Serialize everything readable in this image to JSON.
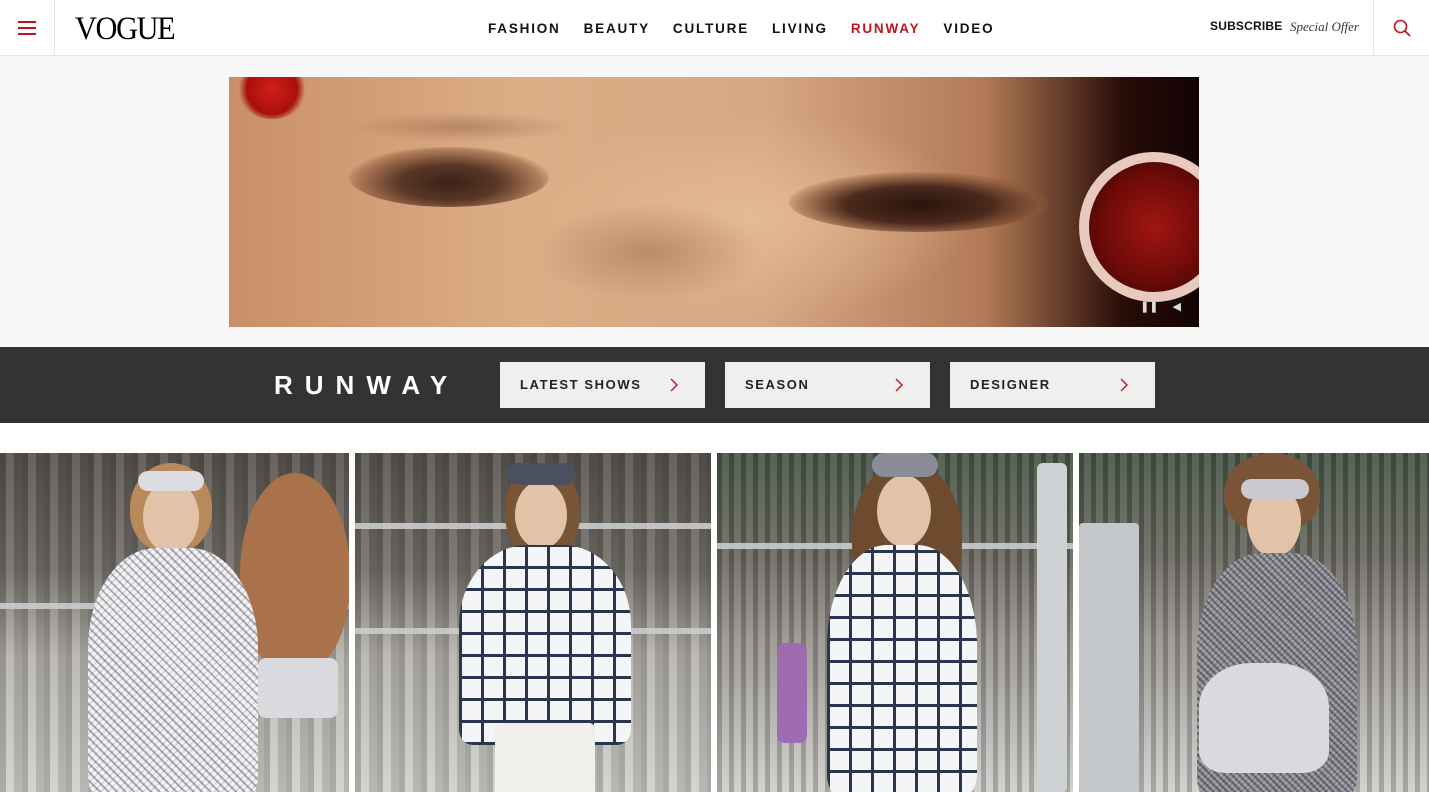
{
  "header": {
    "logo": "VOGUE",
    "nav": [
      "FASHION",
      "BEAUTY",
      "CULTURE",
      "LIVING",
      "RUNWAY",
      "VIDEO"
    ],
    "active_nav": "RUNWAY",
    "subscribe": "SUBSCRIBE",
    "special_offer": "Special Offer",
    "icons": {
      "menu": "hamburger-icon",
      "search": "search-icon"
    },
    "accent_color": "#c1121f"
  },
  "video_ad": {
    "controls": {
      "pause": "pause-icon",
      "volume": "volume-icon"
    },
    "pause_glyph": "❚❚",
    "volume_glyph": "◀"
  },
  "runway_bar": {
    "title": "RUNWAY",
    "background": "#333333",
    "buttons": [
      {
        "label": "LATEST SHOWS"
      },
      {
        "label": "SEASON"
      },
      {
        "label": "DESIGNER"
      }
    ]
  },
  "gallery": {
    "photos": [
      {
        "name": "runway-photo-1"
      },
      {
        "name": "runway-photo-2"
      },
      {
        "name": "runway-photo-3"
      },
      {
        "name": "runway-photo-4"
      }
    ]
  }
}
